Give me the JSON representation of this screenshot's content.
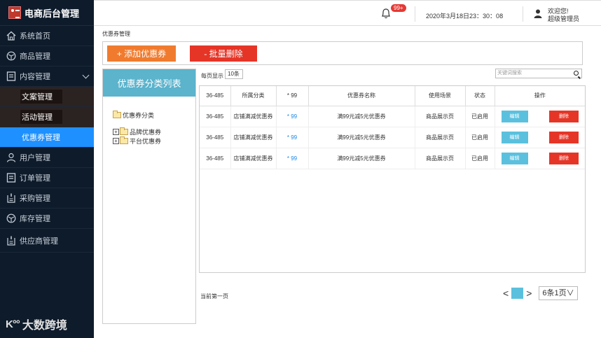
{
  "app": {
    "title": "电商后台管理"
  },
  "sidebar": {
    "items": [
      {
        "label": "系统首页",
        "icon": "home-icon"
      },
      {
        "label": "商品管理",
        "icon": "box-icon"
      },
      {
        "label": "内容管理",
        "icon": "document-icon"
      },
      {
        "label": "用户管理",
        "icon": "user-icon"
      },
      {
        "label": "订单管理",
        "icon": "document-icon"
      },
      {
        "label": "采购管理",
        "icon": "clipboard-icon"
      },
      {
        "label": "库存管理",
        "icon": "box-icon"
      },
      {
        "label": "供应商管理",
        "icon": "clipboard-icon"
      }
    ],
    "sub_items": [
      "文案管理",
      "活动管理",
      "优惠券管理"
    ],
    "footer": "大数跨境",
    "footer_mark": "K°°"
  },
  "header": {
    "notification_count": "99+",
    "datetime": "2020年3月18日23：30：08",
    "welcome": "欢迎您!",
    "role": "超级管理员"
  },
  "breadcrumb": "优惠券管理",
  "toolbar": {
    "add_label": "+ 添加优惠券",
    "batch_delete_label": "- 批量删除"
  },
  "category_panel": {
    "title": "优惠券分类列表",
    "root": "优惠券分类",
    "children": [
      "品牌优惠券",
      "平台优惠券"
    ]
  },
  "list": {
    "page_size_label": "每页显示",
    "page_size": "10条",
    "search_placeholder": "关键词搜索",
    "columns": [
      "36-485",
      "所属分类",
      "* 99",
      "优惠券名称",
      "使用场景",
      "状态",
      "操作"
    ],
    "rows": [
      {
        "id": "36-485",
        "category": "店铺满减优惠券",
        "star": "* 99",
        "name": "满99元减5元优惠券",
        "scene": "商品展示页",
        "status": "已启用",
        "edit": "编辑",
        "delete": "删除"
      },
      {
        "id": "36-485",
        "category": "店铺满减优惠券",
        "star": "* 99",
        "name": "满99元减5元优惠券",
        "scene": "商品展示页",
        "status": "已启用",
        "edit": "编辑",
        "delete": "删除"
      },
      {
        "id": "36-485",
        "category": "店铺满减优惠券",
        "star": "* 99",
        "name": "满99元减5元优惠券",
        "scene": "商品展示页",
        "status": "已启用",
        "edit": "编辑",
        "delete": "删除"
      }
    ]
  },
  "pagination": {
    "current_label": "当前第一页",
    "prev": "<",
    "next": ">",
    "summary": "6条1页∨"
  },
  "colors": {
    "sidebar_bg": "#0e1b2b",
    "active": "#1e90ff",
    "add": "#f07b2e",
    "delete": "#e53527",
    "edit": "#5bc0de"
  }
}
